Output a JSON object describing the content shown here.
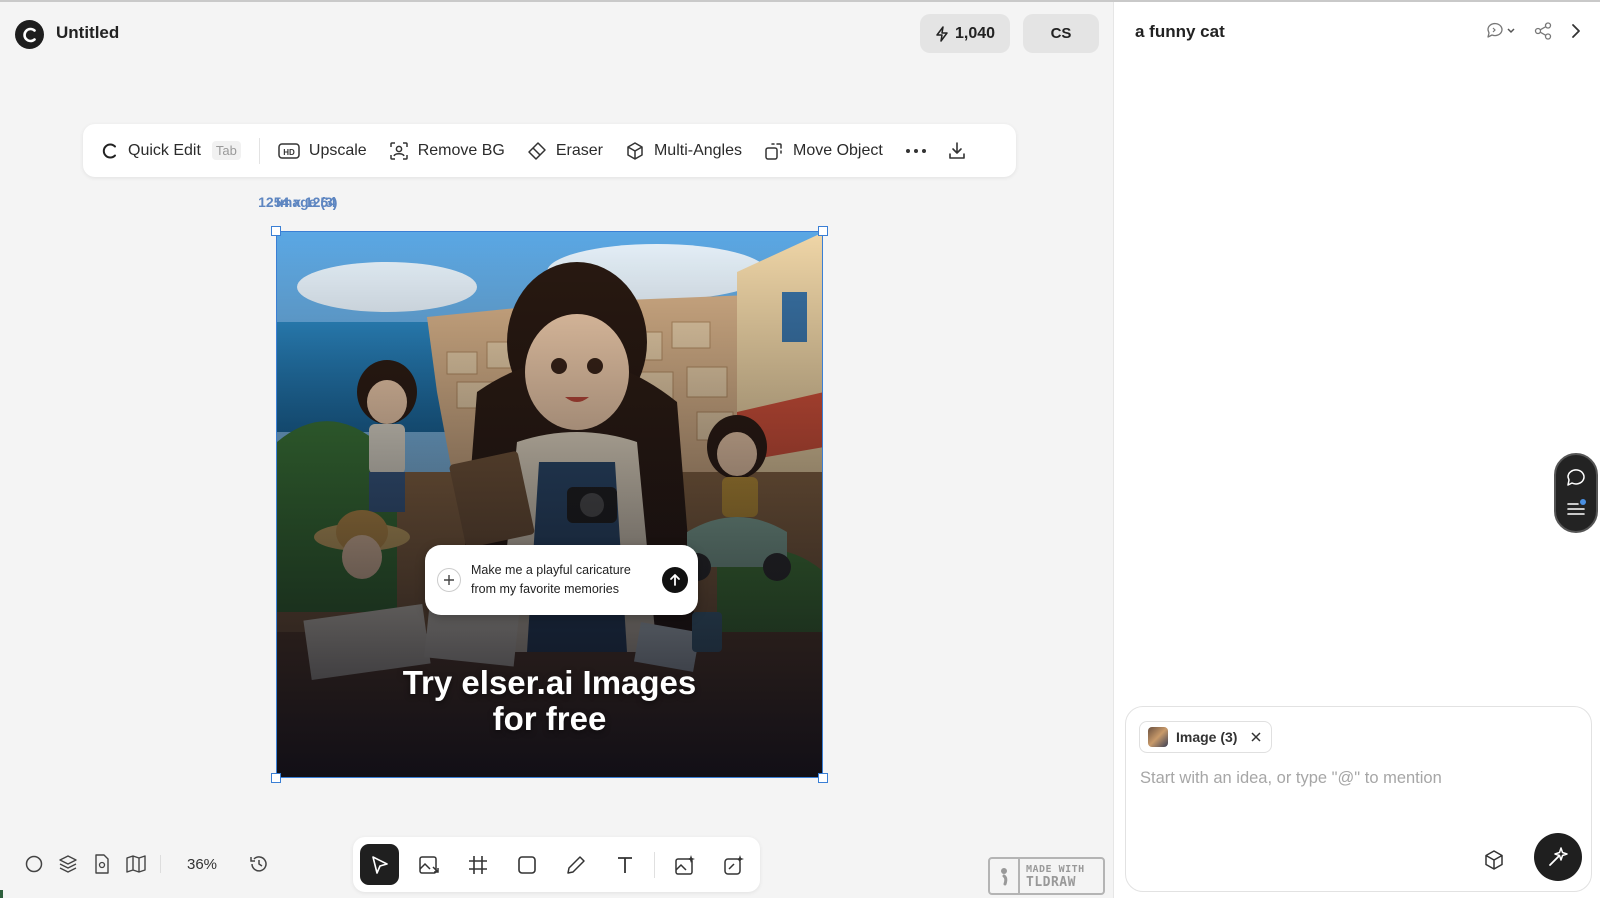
{
  "app": {
    "doc_title": "Untitled",
    "credits": "1,040",
    "user_initials": "CS"
  },
  "toolbar": {
    "quick_edit": "Quick Edit",
    "quick_edit_shortcut": "Tab",
    "upscale": "Upscale",
    "remove_bg": "Remove BG",
    "eraser": "Eraser",
    "multi_angles": "Multi-Angles",
    "move_object": "Move Object"
  },
  "canvas": {
    "image_name": "Image (3)",
    "image_size": "1254 x 1254",
    "zoom": "36%",
    "image_content": {
      "prompt_text": "Make me a playful caricature from my favorite memories",
      "promo_line1": "Try elser.ai Images",
      "promo_line2": "for free"
    }
  },
  "badge": {
    "line1": "MADE WITH",
    "line2": "TLDRAW"
  },
  "panel": {
    "title": "a funny cat",
    "mention_chip": "Image (3)",
    "input_placeholder": "Start with an idea, or type \"@\" to mention"
  },
  "colors": {
    "selection": "#3a7fd5",
    "label": "#5e86c1",
    "dark": "#1f1f1f"
  }
}
